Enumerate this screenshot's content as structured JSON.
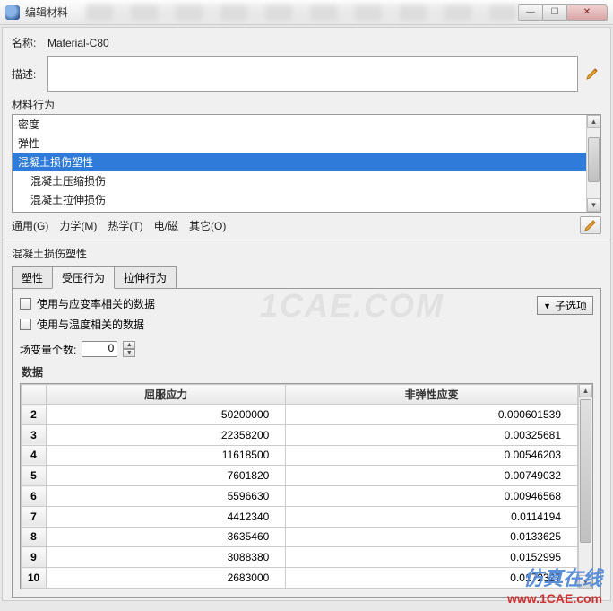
{
  "window": {
    "title": "编辑材料"
  },
  "form": {
    "name_label": "名称:",
    "name_value": "Material-C80",
    "desc_label": "描述:",
    "behavior_label": "材料行为"
  },
  "behaviors": {
    "items": [
      {
        "label": "密度",
        "indent": false,
        "selected": false
      },
      {
        "label": "弹性",
        "indent": false,
        "selected": false
      },
      {
        "label": "混凝土损伤塑性",
        "indent": false,
        "selected": true
      },
      {
        "label": "混凝土压缩损伤",
        "indent": true,
        "selected": false
      },
      {
        "label": "混凝土拉伸损伤",
        "indent": true,
        "selected": false
      }
    ]
  },
  "menus": {
    "general": "通用(G)",
    "mechanics": "力学(M)",
    "thermal": "热学(T)",
    "em": "电/磁",
    "other": "其它(O)"
  },
  "panel": {
    "title": "混凝土损伤塑性",
    "tabs": [
      {
        "label": "塑性"
      },
      {
        "label": "受压行为"
      },
      {
        "label": "拉伸行为"
      }
    ],
    "chk_strain_rate": "使用与应变率相关的数据",
    "chk_temp": "使用与温度相关的数据",
    "sub_options": "子选项",
    "field_vars_label": "场变量个数:",
    "field_vars_value": "0",
    "data_label": "数据",
    "columns": {
      "c1": "屈服应力",
      "c2": "非弹性应变"
    },
    "rows": [
      {
        "n": "2",
        "a": "50200000",
        "b": "0.000601539"
      },
      {
        "n": "3",
        "a": "22358200",
        "b": "0.00325681"
      },
      {
        "n": "4",
        "a": "11618500",
        "b": "0.00546203"
      },
      {
        "n": "5",
        "a": "7601820",
        "b": "0.00749032"
      },
      {
        "n": "6",
        "a": "5596630",
        "b": "0.00946568"
      },
      {
        "n": "7",
        "a": "4412340",
        "b": "0.0114194"
      },
      {
        "n": "8",
        "a": "3635460",
        "b": "0.0133625"
      },
      {
        "n": "9",
        "a": "3088380",
        "b": "0.0152995"
      },
      {
        "n": "10",
        "a": "2683000",
        "b": "0.0172327"
      }
    ]
  },
  "watermark": {
    "text1": "1CAE.COM",
    "text2_cn": "仿真在线",
    "text2_url": "www.1CAE.com"
  }
}
